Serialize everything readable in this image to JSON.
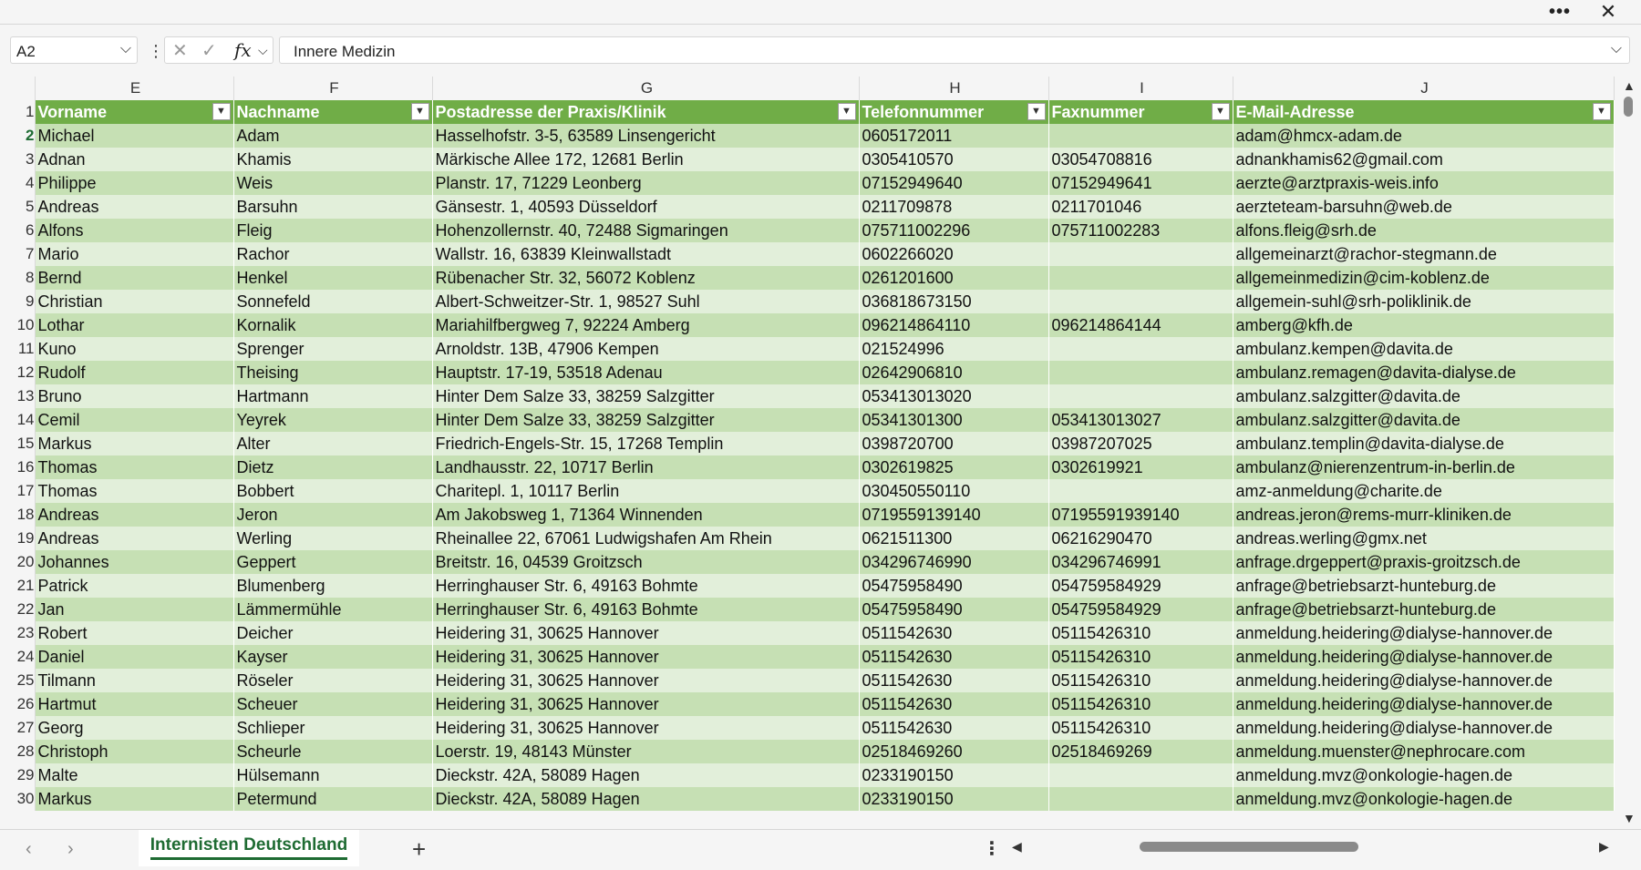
{
  "window": {
    "more_icon": "more-horizontal-icon",
    "close_icon": "close-icon"
  },
  "formula_bar": {
    "name_box": "A2",
    "formula": "Innere Medizin",
    "fx_label": "fx"
  },
  "columns": [
    "E",
    "F",
    "G",
    "H",
    "I",
    "J"
  ],
  "header_row": {
    "row_number": "1",
    "cells": [
      "Vorname",
      "Nachname",
      "Postadresse der Praxis/Klinik",
      "Telefonnummer",
      "Faxnummer",
      "E-Mail-Adresse"
    ]
  },
  "rows": [
    {
      "n": "2",
      "c": [
        "Michael",
        "Adam",
        "Hasselhofstr. 3-5, 63589 Linsengericht",
        "0605172011",
        "",
        "adam@hmcx-adam.de"
      ]
    },
    {
      "n": "3",
      "c": [
        "Adnan",
        "Khamis",
        "Märkische Allee 172, 12681 Berlin",
        "0305410570",
        "03054708816",
        "adnankhamis62@gmail.com"
      ]
    },
    {
      "n": "4",
      "c": [
        "Philippe",
        "Weis",
        "Planstr. 17, 71229 Leonberg",
        "07152949640",
        "07152949641",
        "aerzte@arztpraxis-weis.info"
      ]
    },
    {
      "n": "5",
      "c": [
        "Andreas",
        "Barsuhn",
        "Gänsestr. 1, 40593 Düsseldorf",
        "0211709878",
        "0211701046",
        "aerzteteam-barsuhn@web.de"
      ]
    },
    {
      "n": "6",
      "c": [
        "Alfons",
        "Fleig",
        "Hohenzollernstr. 40, 72488 Sigmaringen",
        "075711002296",
        "075711002283",
        "alfons.fleig@srh.de"
      ]
    },
    {
      "n": "7",
      "c": [
        "Mario",
        "Rachor",
        "Wallstr. 16, 63839 Kleinwallstadt",
        "0602266020",
        "",
        "allgemeinarzt@rachor-stegmann.de"
      ]
    },
    {
      "n": "8",
      "c": [
        "Bernd",
        "Henkel",
        "Rübenacher Str. 32, 56072 Koblenz",
        "0261201600",
        "",
        "allgemeinmedizin@cim-koblenz.de"
      ]
    },
    {
      "n": "9",
      "c": [
        "Christian",
        "Sonnefeld",
        "Albert-Schweitzer-Str. 1, 98527 Suhl",
        "036818673150",
        "",
        "allgemein-suhl@srh-poliklinik.de"
      ]
    },
    {
      "n": "10",
      "c": [
        "Lothar",
        "Kornalik",
        "Mariahilfbergweg 7, 92224 Amberg",
        "096214864110",
        "096214864144",
        "amberg@kfh.de"
      ]
    },
    {
      "n": "11",
      "c": [
        "Kuno",
        "Sprenger",
        "Arnoldstr. 13B, 47906 Kempen",
        "021524996",
        "",
        "ambulanz.kempen@davita.de"
      ]
    },
    {
      "n": "12",
      "c": [
        "Rudolf",
        "Theising",
        "Hauptstr. 17-19, 53518 Adenau",
        "02642906810",
        "",
        "ambulanz.remagen@davita-dialyse.de"
      ]
    },
    {
      "n": "13",
      "c": [
        "Bruno",
        "Hartmann",
        "Hinter Dem Salze 33, 38259 Salzgitter",
        "053413013020",
        "",
        "ambulanz.salzgitter@davita.de"
      ]
    },
    {
      "n": "14",
      "c": [
        "Cemil",
        "Yeyrek",
        "Hinter Dem Salze 33, 38259 Salzgitter",
        "05341301300",
        "053413013027",
        "ambulanz.salzgitter@davita.de"
      ]
    },
    {
      "n": "15",
      "c": [
        "Markus",
        "Alter",
        "Friedrich-Engels-Str. 15, 17268 Templin",
        "0398720700",
        "03987207025",
        "ambulanz.templin@davita-dialyse.de"
      ]
    },
    {
      "n": "16",
      "c": [
        "Thomas",
        "Dietz",
        "Landhausstr. 22, 10717 Berlin",
        "0302619825",
        "0302619921",
        "ambulanz@nierenzentrum-in-berlin.de"
      ]
    },
    {
      "n": "17",
      "c": [
        "Thomas",
        "Bobbert",
        "Charitepl. 1, 10117 Berlin",
        "030450550110",
        "",
        "amz-anmeldung@charite.de"
      ]
    },
    {
      "n": "18",
      "c": [
        "Andreas",
        "Jeron",
        "Am Jakobsweg 1, 71364 Winnenden",
        "0719559139140",
        "07195591939140",
        "andreas.jeron@rems-murr-kliniken.de"
      ]
    },
    {
      "n": "19",
      "c": [
        "Andreas",
        "Werling",
        "Rheinallee 22, 67061 Ludwigshafen Am Rhein",
        "0621511300",
        "06216290470",
        "andreas.werling@gmx.net"
      ]
    },
    {
      "n": "20",
      "c": [
        "Johannes",
        "Geppert",
        "Breitstr. 16, 04539 Groitzsch",
        "034296746990",
        "034296746991",
        "anfrage.drgeppert@praxis-groitzsch.de"
      ]
    },
    {
      "n": "21",
      "c": [
        "Patrick",
        "Blumenberg",
        "Herringhauser Str. 6, 49163 Bohmte",
        "05475958490",
        "054759584929",
        "anfrage@betriebsarzt-hunteburg.de"
      ]
    },
    {
      "n": "22",
      "c": [
        "Jan",
        "Lämmermühle",
        "Herringhauser Str. 6, 49163 Bohmte",
        "05475958490",
        "054759584929",
        "anfrage@betriebsarzt-hunteburg.de"
      ]
    },
    {
      "n": "23",
      "c": [
        "Robert",
        "Deicher",
        "Heidering 31, 30625 Hannover",
        "0511542630",
        "05115426310",
        "anmeldung.heidering@dialyse-hannover.de"
      ]
    },
    {
      "n": "24",
      "c": [
        "Daniel",
        "Kayser",
        "Heidering 31, 30625 Hannover",
        "0511542630",
        "05115426310",
        "anmeldung.heidering@dialyse-hannover.de"
      ]
    },
    {
      "n": "25",
      "c": [
        "Tilmann",
        "Röseler",
        "Heidering 31, 30625 Hannover",
        "0511542630",
        "05115426310",
        "anmeldung.heidering@dialyse-hannover.de"
      ]
    },
    {
      "n": "26",
      "c": [
        "Hartmut",
        "Scheuer",
        "Heidering 31, 30625 Hannover",
        "0511542630",
        "05115426310",
        "anmeldung.heidering@dialyse-hannover.de"
      ]
    },
    {
      "n": "27",
      "c": [
        "Georg",
        "Schlieper",
        "Heidering 31, 30625 Hannover",
        "0511542630",
        "05115426310",
        "anmeldung.heidering@dialyse-hannover.de"
      ]
    },
    {
      "n": "28",
      "c": [
        "Christoph",
        "Scheurle",
        "Loerstr. 19, 48143 Münster",
        "02518469260",
        "02518469269",
        "anmeldung.muenster@nephrocare.com"
      ]
    },
    {
      "n": "29",
      "c": [
        "Malte",
        "Hülsemann",
        "Dieckstr. 42A, 58089 Hagen",
        "0233190150",
        "",
        "anmeldung.mvz@onkologie-hagen.de"
      ]
    },
    {
      "n": "30",
      "c": [
        "Markus",
        "Petermund",
        "Dieckstr. 42A, 58089 Hagen",
        "0233190150",
        "",
        "anmeldung.mvz@onkologie-hagen.de"
      ]
    }
  ],
  "sheet_tabs": {
    "active": "Internisten Deutschland",
    "add_icon": "plus-icon"
  },
  "colors": {
    "header_green": "#70ad47",
    "band_dark": "#c6e0b4",
    "band_light": "#e2efda",
    "accent": "#1e6b32"
  }
}
